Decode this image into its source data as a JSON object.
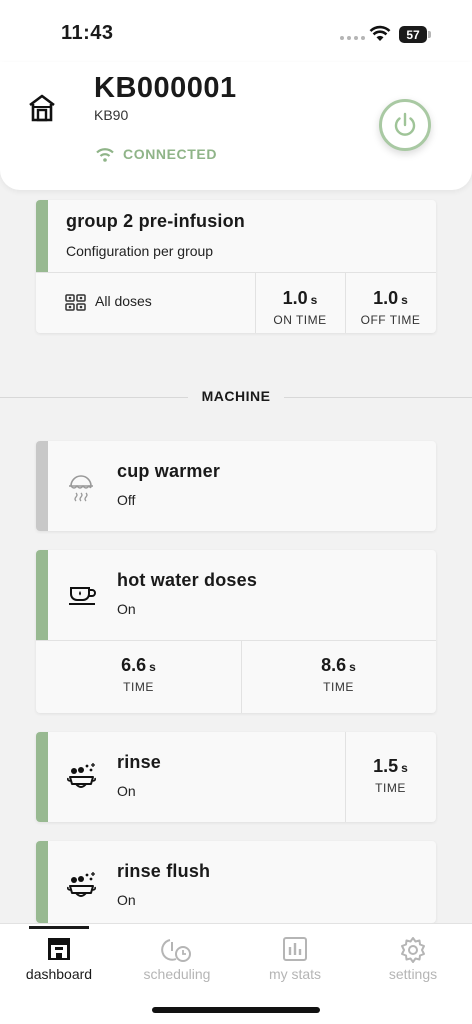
{
  "status_bar": {
    "time": "11:43",
    "battery": "57"
  },
  "header": {
    "machine_id": "KB000001",
    "model": "KB90",
    "connection": "CONNECTED"
  },
  "preinfusion": {
    "title": "group 2 pre-infusion",
    "subtitle": "Configuration per group",
    "doses_label": "All doses",
    "on_time": {
      "value": "1.0",
      "unit": "s",
      "label": "ON TIME"
    },
    "off_time": {
      "value": "1.0",
      "unit": "s",
      "label": "OFF TIME"
    }
  },
  "section_label": "MACHINE",
  "cup_warmer": {
    "title": "cup warmer",
    "status": "Off"
  },
  "hot_water": {
    "title": "hot water doses",
    "status": "On",
    "time1": {
      "value": "6.6",
      "unit": "s",
      "label": "TIME"
    },
    "time2": {
      "value": "8.6",
      "unit": "s",
      "label": "TIME"
    }
  },
  "rinse": {
    "title": "rinse",
    "status": "On",
    "time": {
      "value": "1.5",
      "unit": "s",
      "label": "TIME"
    }
  },
  "rinse_flush": {
    "title": "rinse flush",
    "status": "On"
  },
  "nav": {
    "dashboard": "dashboard",
    "scheduling": "scheduling",
    "stats": "my stats",
    "settings": "settings"
  },
  "colors": {
    "accent_green": "#98b991",
    "inactive_gray": "#c8c8c8"
  }
}
